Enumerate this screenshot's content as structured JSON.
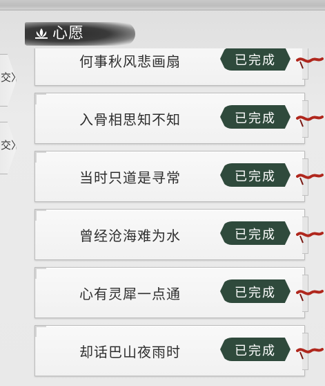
{
  "header": {
    "title": "心愿",
    "icon": "lotus-icon"
  },
  "side_tabs": [
    {
      "label": "交〉"
    },
    {
      "label": "交〉"
    }
  ],
  "wishes": [
    {
      "text": "何事秋风悲画扇",
      "status": "已完成"
    },
    {
      "text": "入骨相思知不知",
      "status": "已完成"
    },
    {
      "text": "当时只道是寻常",
      "status": "已完成"
    },
    {
      "text": "曾经沧海难为水",
      "status": "已完成"
    },
    {
      "text": "心有灵犀一点通",
      "status": "已完成"
    },
    {
      "text": "却话巴山夜雨时",
      "status": "已完成"
    }
  ],
  "colors": {
    "badge": "#2f4a3c",
    "ribbon": "#b0271d"
  }
}
